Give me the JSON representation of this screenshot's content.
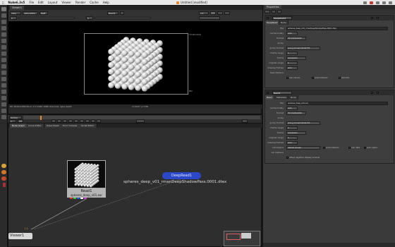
{
  "menubar": {
    "apple": "",
    "app": "Nuke6.3v5",
    "items": [
      "File",
      "Edit",
      "Layout",
      "Viewer",
      "Render",
      "Cache",
      "Help"
    ],
    "doc_title": "Untitled [modified]"
  },
  "viewer": {
    "tab": "Viewer1",
    "channels": "rgba",
    "layer": "rgba.alpha",
    "display": "RGB",
    "input": "Read1",
    "zoom": "1:1",
    "gain": "1",
    "frame_label_tl": "2048x1556",
    "frame_res": "HD",
    "info": "HD 1920x1080 bbox: 0 0 1920 1080 channels: rgba,depth",
    "coords": "x=2047 y=138"
  },
  "timeline": {
    "mode": "Global",
    "frame": "1",
    "fps": "24",
    "current_frame": "1"
  },
  "nodegraph": {
    "tabs": [
      "Node Graph",
      "Curve Editor",
      "Dope Sheet",
      "Error Console",
      "Script Editor"
    ],
    "read_node": {
      "label": "Read1",
      "file": "spheres_deep_v01.exr"
    },
    "deepread_node": {
      "label": "DeepRead1",
      "file": "spheres_deep_v01_rmanDeepShadowPass.0001.dtex"
    },
    "viewer_node": {
      "label": "Viewer1",
      "inputs": "1 2"
    }
  },
  "properties": {
    "tab": "Properties",
    "deepread_panel": {
      "name": "DeepRead1",
      "tabs": [
        "DeepRead",
        "Node"
      ],
      "rows": [
        {
          "label": "file",
          "value": "spheres_deep_v01_rmanDeepShadowPass.0001.dtex"
        },
        {
          "label": "cache locally",
          "value": "auto"
        },
        {
          "label": "format",
          "value": "HD 1920x1080"
        },
        {
          "label": "proxy",
          "value": ""
        },
        {
          "label": "proxy format",
          "value": "proxy_format 1024x778"
        },
        {
          "label": "frame range",
          "value": "1"
        },
        {
          "label": "frame",
          "value": "expression"
        },
        {
          "label": "original range",
          "value": "1"
        },
        {
          "label": "missing frames",
          "value": "error"
        },
        {
          "label": "Raw Options",
          "value": ""
        }
      ],
      "raw_checks": [
        "raw values",
        "premultiplied",
        "discrete"
      ]
    },
    "read_panel": {
      "name": "Read1",
      "tabs": [
        "Read",
        "Metadata",
        "Node"
      ],
      "rows": [
        {
          "label": "file",
          "value": "spheres_deep_v01.exr"
        },
        {
          "label": "cache locally",
          "value": "auto"
        },
        {
          "label": "format",
          "value": "HD 1920x1080"
        },
        {
          "label": "proxy",
          "value": ""
        },
        {
          "label": "proxy format",
          "value": "proxy_format 1024x778"
        },
        {
          "label": "frame range",
          "value": "1"
        },
        {
          "label": "frame",
          "value": "expression"
        },
        {
          "label": "original range",
          "value": "1"
        },
        {
          "label": "missing frames",
          "value": "error"
        },
        {
          "label": "colorspace",
          "value": "default (linear)"
        },
        {
          "label": "exr Options",
          "value": ""
        }
      ],
      "color_checks": [
        "premultiplied",
        "raw data",
        "auto alpha"
      ],
      "exr_check": "offset negative display window"
    }
  }
}
